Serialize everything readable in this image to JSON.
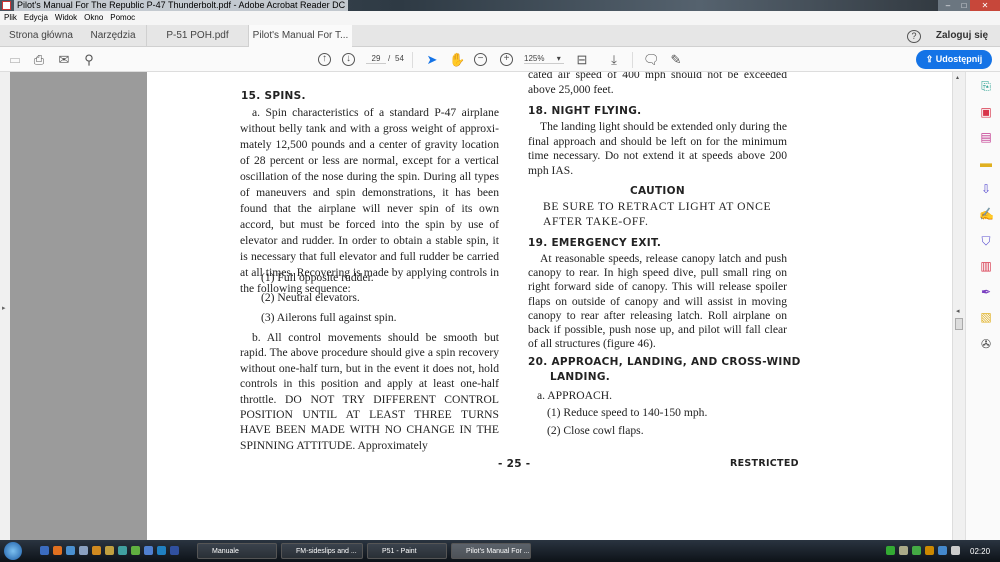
{
  "window": {
    "title": "Pilot's Manual For The Republic P-47 Thunderbolt.pdf - Adobe Acrobat Reader DC"
  },
  "menu": [
    "Plik",
    "Edycja",
    "Widok",
    "Okno",
    "Pomoc"
  ],
  "tabs": {
    "home": "Strona główna",
    "tools": "Narzędzia",
    "doc1": "P-51 POH.pdf",
    "doc2": "Pilot's Manual For T...",
    "close": "×"
  },
  "account": {
    "help": "?",
    "login": "Zaloguj się"
  },
  "toolbar": {
    "page_current": "29",
    "page_sep": "/",
    "page_total": "54",
    "zoom": "125%",
    "share": "Udostępnij"
  },
  "page": {
    "left": {
      "h15": "15. SPINS.",
      "a": "a. Spin characteristics of a standard P-47 airplane without belly tank and with a gross weight of approxi­mately 12,500 pounds and a center of gravity location of 28 percent or less are normal, except for a vertical oscilla­tion of the nose during the spin. During all types of maneuvers and spin demonstrations, it has been found that the airplane will never spin of its own accord, but must be forced into the spin by use of elevator and rudder. In order to obtain a stable spin, it is necessary that full elevator and full rudder be carried at all times. Recovering is made by applying controls in the follow­ing sequence:",
      "items": [
        "(1) Full opposite rudder.",
        "(2) Neutral elevators.",
        "(3) Ailerons full against spin."
      ],
      "b": "b. All control movements should be smooth but rapid. The above procedure should give a spin re­covery without one-half turn, but in the event it does not, hold controls in this position and apply at least one-half throttle. DO NOT TRY DIFFERENT CON­TROL POSITION UNTIL AT LEAST THREE TURNS HAVE BEEN MADE WITH NO CHANGE IN THE SPINNING ATTITUDE. Approximately"
    },
    "right": {
      "top": "cated air speed of 400 mph should not be exceeded above 25,000 feet.",
      "h18": "18. NIGHT FLYING.",
      "p18": "The landing light should be extended only during the final approach and should be left on for the mini­mum time necessary. Do not extend it at speeds above 200 mph IAS.",
      "caution": "CAUTION",
      "caution_text": "BE SURE TO RETRACT LIGHT AT ONCE AFTER TAKE-OFF.",
      "h19": "19. EMERGENCY EXIT.",
      "p19": "At reasonable speeds, release canopy latch and push canopy to rear. In high speed dive, pull small ring on right forward side of canopy. This will release spoiler flaps on outside of canopy and will assist in moving canopy to rear after releasing latch. Roll air­plane on back if possible, push nose up, and pilot will fall clear of all structures (figure 46).",
      "h20a": "20. APPROACH, LANDING, AND CROSS-WIND",
      "h20b": "LANDING.",
      "approach": "a. APPROACH.",
      "items": [
        "(1) Reduce speed to 140-150 mph.",
        "(2) Close cowl flaps."
      ]
    },
    "footer": {
      "page_no": "- 25 -",
      "mark": "RESTRICTED"
    }
  },
  "taskbar": {
    "items": [
      "Manuale",
      "FM-sideslips and ...",
      "P51 - Paint",
      "Pilot's Manual For ..."
    ],
    "clock": "02:20"
  }
}
